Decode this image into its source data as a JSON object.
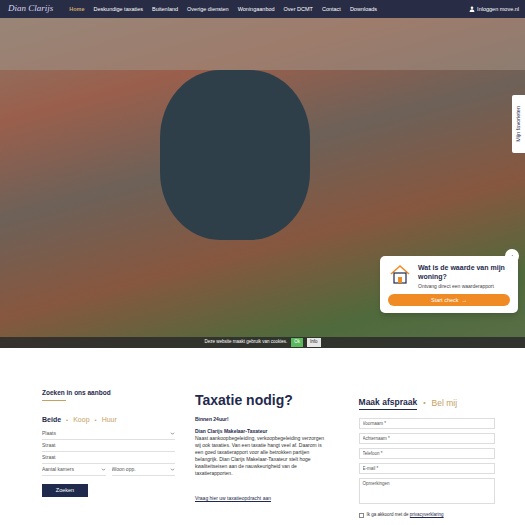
{
  "nav": {
    "logo": "Dian Clarijs",
    "items": [
      {
        "label": "Home",
        "selected": true
      },
      {
        "label": "Deskundige taxaties",
        "selected": false
      },
      {
        "label": "Buitenland",
        "selected": false
      },
      {
        "label": "Overige diensten",
        "selected": false
      },
      {
        "label": "Woningaanbod",
        "selected": false
      },
      {
        "label": "Over DCMT",
        "selected": false
      },
      {
        "label": "Contact",
        "selected": false
      },
      {
        "label": "Downloads",
        "selected": false
      }
    ],
    "login": "Inloggen move.nl"
  },
  "favorites_tab": "Mijn favorieten",
  "popup": {
    "title": "Wat is de waarde van mijn woning?",
    "subtitle": "Ontvang direct een waarderapport",
    "button": "Start check",
    "arrow": "→"
  },
  "cookie": {
    "text": "Deze website maakt gebruik van cookies.",
    "ok": "Ok",
    "info": "Info"
  },
  "search": {
    "title": "Zoeken in ons aanbod",
    "separator": "•",
    "tabs": [
      {
        "label": "Beide",
        "selected": true
      },
      {
        "label": "Koop",
        "selected": false
      },
      {
        "label": "Huur",
        "selected": false
      }
    ],
    "rows": [
      [
        {
          "placeholder": "Plaats",
          "kind": "select"
        }
      ],
      [
        {
          "placeholder": "Straat",
          "kind": "text"
        }
      ],
      [
        {
          "placeholder": "Straat",
          "kind": "text"
        }
      ],
      [
        {
          "placeholder": "Aantal kamers",
          "kind": "select"
        },
        {
          "placeholder": "Woon opp.",
          "kind": "select"
        }
      ]
    ],
    "button": "Zoeken"
  },
  "taxatie": {
    "title": "Taxatie nodig?",
    "lead": "Binnen 24uur!",
    "subtitle": "Dian Clarijs Makelaar-Taxateur",
    "body": "Naast aankoopbegeleiding, verkoopbegeleiding verzorgen wij ook taxaties. Van een taxatie hangt veel af. Daarom is een goed taxatierapport voor alle betrokken partijen belangrijk. Dian Clarijs Makelaar-Taxateur stelt hoge kwaliteitseisen aan de nauwkeurigheid van de taxatierapporten.",
    "link": "Vraag hier uw taxatieopdracht aan"
  },
  "appointment": {
    "separator": "•",
    "tabs": [
      {
        "label": "Maak afspraak",
        "selected": true
      },
      {
        "label": "Bel mij",
        "selected": false
      }
    ],
    "fields": [
      {
        "placeholder": "Voornaam *",
        "kind": "text"
      },
      {
        "placeholder": "Achternaam *",
        "kind": "text"
      },
      {
        "placeholder": "Telefoon *",
        "kind": "text"
      },
      {
        "placeholder": "E-mail *",
        "kind": "text"
      },
      {
        "placeholder": "Opmerkingen",
        "kind": "textarea"
      }
    ],
    "consent": {
      "before": "Ik ga akkoord met de ",
      "link": "privacyverklaring",
      "checked": false
    }
  }
}
